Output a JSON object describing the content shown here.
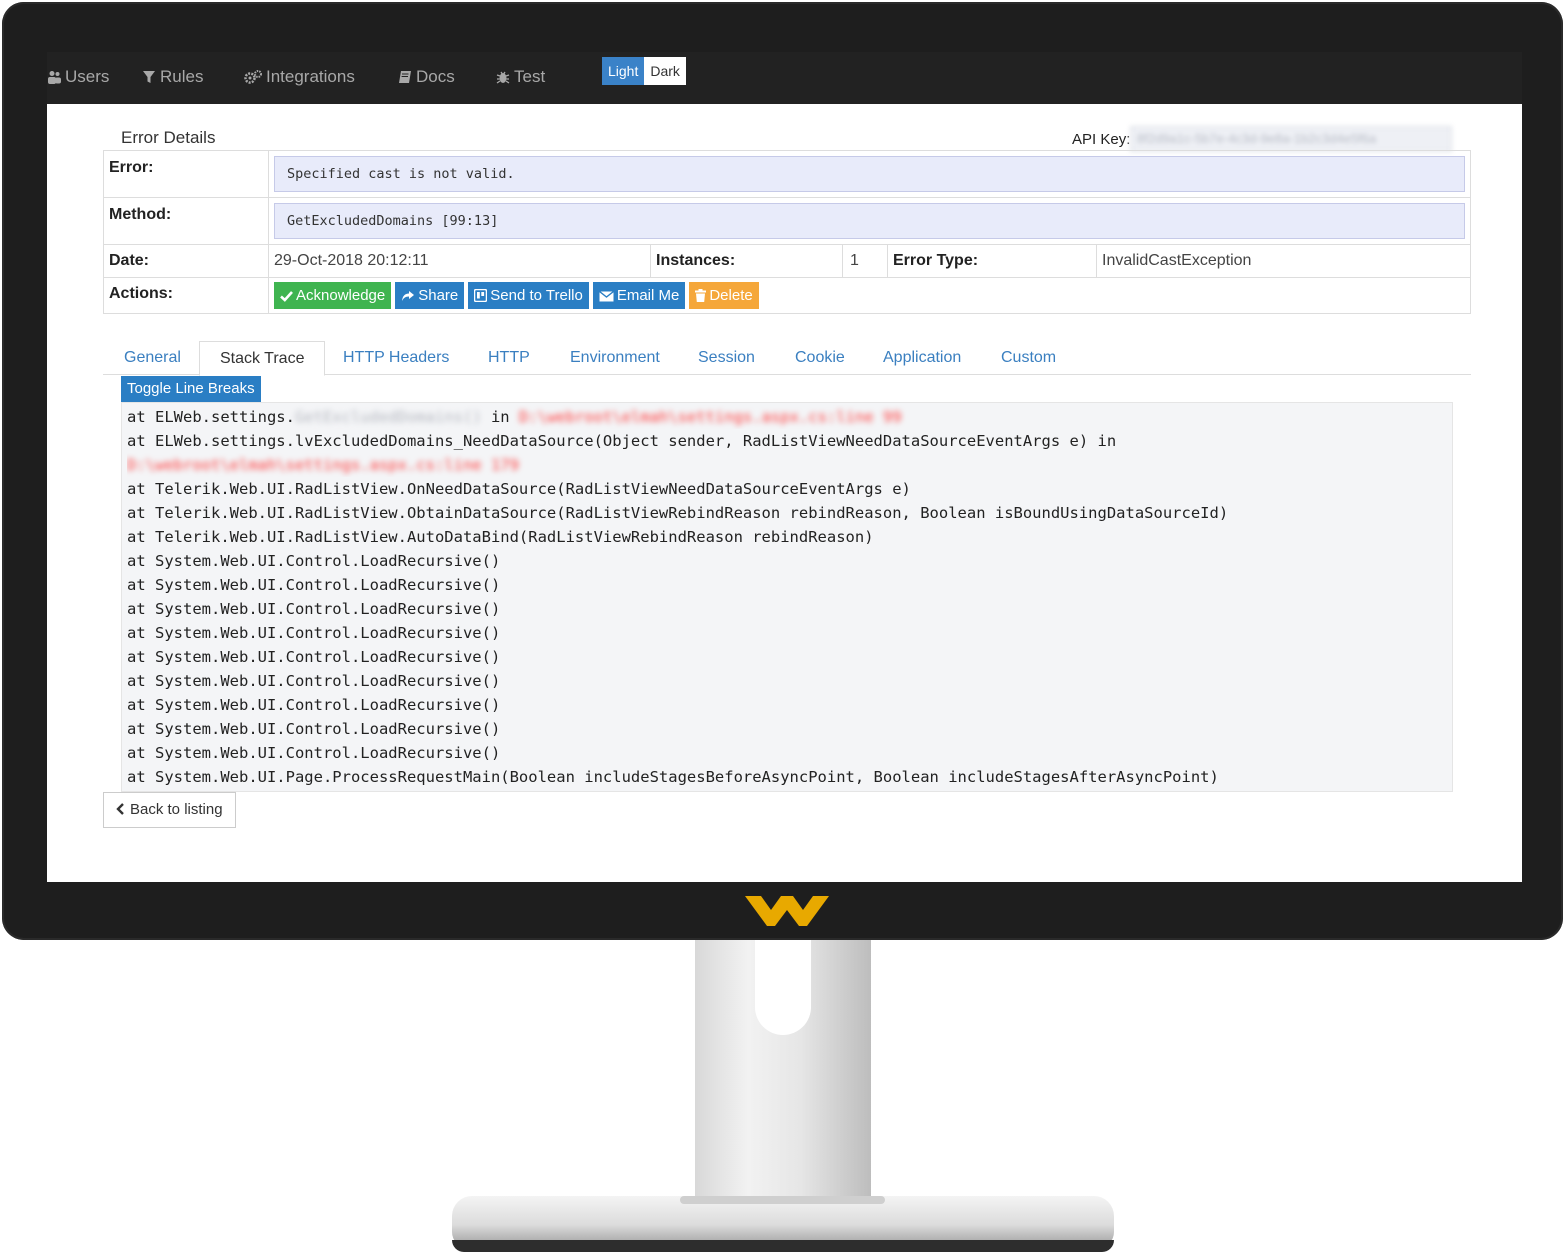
{
  "nav": {
    "items": [
      {
        "label": "Users",
        "icon": "users-icon"
      },
      {
        "label": "Rules",
        "icon": "filter-icon"
      },
      {
        "label": "Integrations",
        "icon": "cogs-icon"
      },
      {
        "label": "Docs",
        "icon": "book-icon"
      },
      {
        "label": "Test",
        "icon": "bug-icon"
      }
    ],
    "theme_light": "Light",
    "theme_dark": "Dark"
  },
  "panel": {
    "title": "Error Details",
    "api_key_label": "API Key:",
    "api_key_value": "8f2d9a1c-5b7e-4c3d-9e8a-1b2c3d4e5f6a",
    "error_label": "Error:",
    "error_value": "Specified cast is not valid.",
    "method_label": "Method:",
    "method_value": "GetExcludedDomains [99:13]",
    "date_label": "Date:",
    "date_value": "29-Oct-2018 20:12:11",
    "instances_label": "Instances:",
    "instances_value": "1",
    "error_type_label": "Error Type:",
    "error_type_value": "InvalidCastException",
    "actions_label": "Actions:"
  },
  "actions": {
    "acknowledge": "Acknowledge",
    "share": "Share",
    "trello": "Send to Trello",
    "email": "Email Me",
    "delete": "Delete"
  },
  "tabs": [
    "General",
    "Stack Trace",
    "HTTP Headers",
    "HTTP",
    "Environment",
    "Session",
    "Cookie",
    "Application",
    "Custom"
  ],
  "toggle_label": "Toggle Line Breaks",
  "trace": {
    "line1_prefix": "at ELWeb.settings.",
    "line1_blur": "GetExcludedDomains()",
    "line1_in": " in ",
    "line1_path": "D:\\webroot\\elmah\\settings.aspx.cs:line 99",
    "line2": "at ELWeb.settings.lvExcludedDomains_NeedDataSource(Object sender, RadListViewNeedDataSourceEventArgs e) in",
    "line3_path": "D:\\webroot\\elmah\\settings.aspx.cs:line 179",
    "lines": [
      "at Telerik.Web.UI.RadListView.OnNeedDataSource(RadListViewNeedDataSourceEventArgs e)",
      "at Telerik.Web.UI.RadListView.ObtainDataSource(RadListViewRebindReason rebindReason, Boolean isBoundUsingDataSourceId)",
      "at Telerik.Web.UI.RadListView.AutoDataBind(RadListViewRebindReason rebindReason)",
      "at System.Web.UI.Control.LoadRecursive()",
      "at System.Web.UI.Control.LoadRecursive()",
      "at System.Web.UI.Control.LoadRecursive()",
      "at System.Web.UI.Control.LoadRecursive()",
      "at System.Web.UI.Control.LoadRecursive()",
      "at System.Web.UI.Control.LoadRecursive()",
      "at System.Web.UI.Control.LoadRecursive()",
      "at System.Web.UI.Control.LoadRecursive()",
      "at System.Web.UI.Control.LoadRecursive()",
      "at System.Web.UI.Page.ProcessRequestMain(Boolean includeStagesBeforeAsyncPoint, Boolean includeStagesAfterAsyncPoint)"
    ]
  },
  "back_label": "Back to listing",
  "colors": {
    "navbar": "#222222",
    "accent_blue": "#2a7ec4",
    "success_green": "#3fb450",
    "warning_orange": "#f5a73a",
    "logo_gold": "#e8a900"
  }
}
